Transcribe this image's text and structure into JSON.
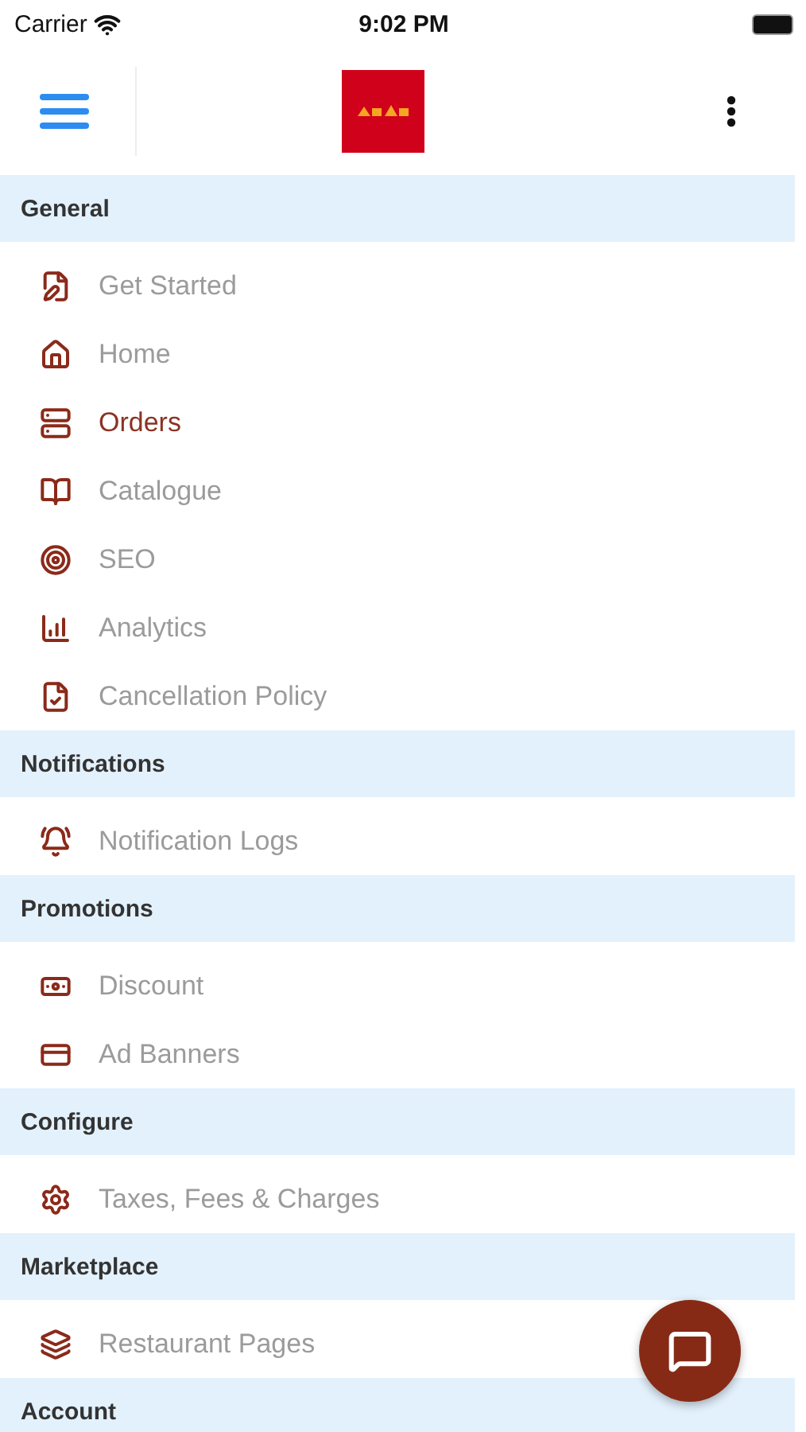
{
  "status_bar": {
    "carrier": "Carrier",
    "time": "9:02 PM"
  },
  "sections": [
    {
      "title": "General",
      "items": [
        {
          "label": "Get Started",
          "selected": false
        },
        {
          "label": "Home",
          "selected": false
        },
        {
          "label": "Orders",
          "selected": true
        },
        {
          "label": "Catalogue",
          "selected": false
        },
        {
          "label": "SEO",
          "selected": false
        },
        {
          "label": "Analytics",
          "selected": false
        },
        {
          "label": "Cancellation Policy",
          "selected": false
        }
      ]
    },
    {
      "title": "Notifications",
      "items": [
        {
          "label": "Notification Logs",
          "selected": false
        }
      ]
    },
    {
      "title": "Promotions",
      "items": [
        {
          "label": "Discount",
          "selected": false
        },
        {
          "label": "Ad Banners",
          "selected": false
        }
      ]
    },
    {
      "title": "Configure",
      "items": [
        {
          "label": "Taxes, Fees & Charges",
          "selected": false
        }
      ]
    },
    {
      "title": "Marketplace",
      "items": [
        {
          "label": "Restaurant Pages",
          "selected": false
        }
      ]
    },
    {
      "title": "Account"
    }
  ]
}
